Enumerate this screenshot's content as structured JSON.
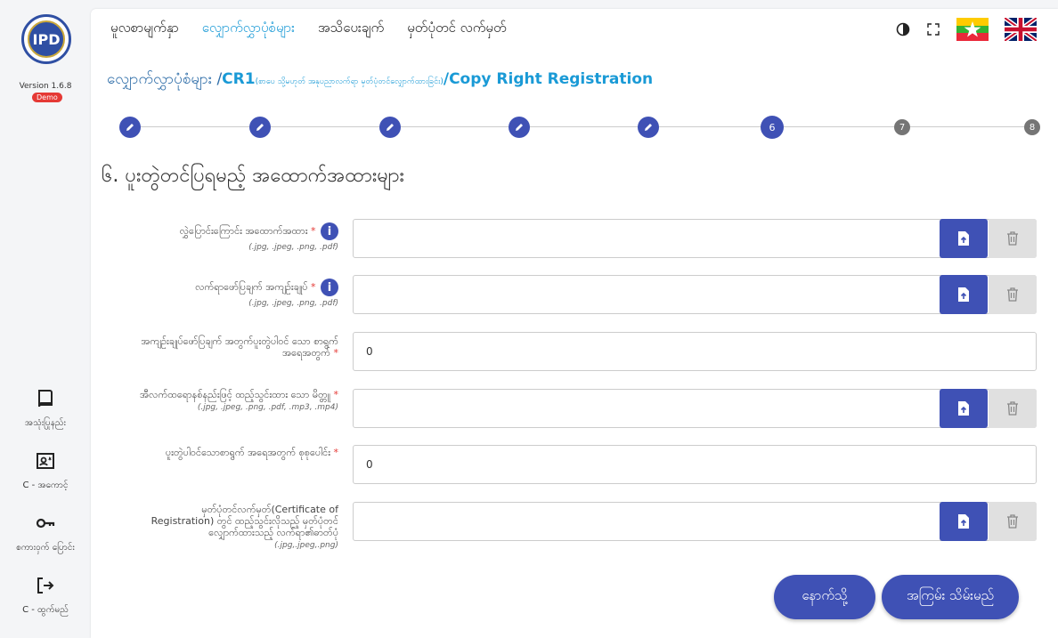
{
  "app": {
    "logo_text": "IPD",
    "version": "Version 1.6.8",
    "badge": "Demo"
  },
  "sidebar": {
    "items": [
      {
        "label": "အသုံးပြုနည်း",
        "icon": "book-icon"
      },
      {
        "label": "C - အကောင့်",
        "icon": "account-card-icon"
      },
      {
        "label": "စကားဝှက် ပြောင်း",
        "icon": "key-icon"
      },
      {
        "label": "C - ထွက်မည်",
        "icon": "logout-icon"
      }
    ]
  },
  "topnav": {
    "items": [
      {
        "label": "မူလစာမျက်နှာ",
        "active": false
      },
      {
        "label": "လျှောက်လွှာပုံစံများ",
        "active": true
      },
      {
        "label": "အသိပေးချက်",
        "active": false
      },
      {
        "label": "မှတ်ပုံတင် လက်မှတ်",
        "active": false
      }
    ]
  },
  "breadcrumb": {
    "part1": "လျှောက်လွှာပုံစံများ /",
    "code": "CR1",
    "note": "(စာပေ သို့မဟုတ် အနုပညာလက်ရာ မှတ်ပုံတင်လျှောက်ထားခြင်း)",
    "part2": "/Copy Right Registration"
  },
  "stepper": {
    "steps": [
      {
        "label": "",
        "state": "done"
      },
      {
        "label": "",
        "state": "done"
      },
      {
        "label": "",
        "state": "done"
      },
      {
        "label": "",
        "state": "done"
      },
      {
        "label": "",
        "state": "done"
      },
      {
        "label": "6",
        "state": "current"
      },
      {
        "label": "7",
        "state": "todo"
      },
      {
        "label": "8",
        "state": "todo"
      }
    ]
  },
  "section": {
    "title": "၆. ပူးတွဲတင်ပြရမည့် အထောက်အထားများ"
  },
  "form": {
    "rows": [
      {
        "label": "လွှဲပြောင်းကြောင်း အထောက်အထား",
        "required": "*",
        "hint": "(.jpg, .jpeg, .png, .pdf)",
        "type": "file",
        "info": "i"
      },
      {
        "label": "လက်ရာဖော်ပြချက် အကျဉ်းချုပ်",
        "required": "*",
        "hint": "(.jpg, .jpeg, .png, .pdf)",
        "type": "file",
        "info": "i"
      },
      {
        "label": "အကျဉ်းချုပ်ဖော်ပြချက် အတွက်ပူးတွဲပါဝင် သော စာရွက် အရေအတွက်",
        "required": "*",
        "hint": "",
        "type": "text",
        "value": "0"
      },
      {
        "label": "အီလက်ထရောနစ်နည်းဖြင့် ထည့်သွင်းထား သော မိတ္တူ",
        "required": "*",
        "hint": "(.jpg, .jpeg, .png, .pdf, .mp3, .mp4)",
        "type": "file"
      },
      {
        "label": "ပူးတွဲပါဝင်သောစာရွက် အရေအတွက် စုစုပေါင်း",
        "required": "*",
        "hint": "",
        "type": "text",
        "value": "0"
      },
      {
        "label": "မှတ်ပုံတင်လက်မှတ်(Certificate of Registration) တွင် ထည့်သွင်းလိုသည့် မှတ်ပုံတင်လျှောက်ထားသည့် လက်ရာ၏ဓာတ်ပုံ",
        "required": "",
        "hint": "(.jpg,.jpeg,.png)",
        "type": "file"
      }
    ]
  },
  "buttons": {
    "back": "နောက်သို့",
    "save": "အကြမ်း သိမ်းမည်"
  },
  "colors": {
    "primary": "#3f51b5",
    "accent": "#1a9ad6",
    "required": "#e53935"
  }
}
